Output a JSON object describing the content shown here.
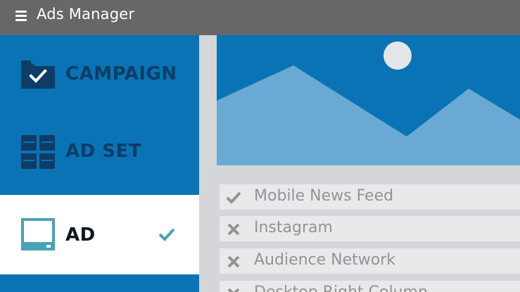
{
  "header": {
    "title": "Ads Manager",
    "menu_icon": "hamburger-menu-icon"
  },
  "sidebar": {
    "items": [
      {
        "label": "CAMPAIGN",
        "icon": "folder-check-icon",
        "selected": false
      },
      {
        "label": "AD SET",
        "icon": "grid-icon",
        "selected": false
      },
      {
        "label": "AD",
        "icon": "monitor-icon",
        "selected": true,
        "status_icon": "checkmark-icon"
      }
    ]
  },
  "preview": {
    "icon": "landscape-image-icon"
  },
  "placements": {
    "items": [
      {
        "label": "Mobile News Feed",
        "state": "checked",
        "icon": "checkmark-icon"
      },
      {
        "label": "Instagram",
        "state": "excluded",
        "icon": "x-icon"
      },
      {
        "label": "Audience Network",
        "state": "excluded",
        "icon": "x-icon"
      },
      {
        "label": "Desktop Right Column",
        "state": "excluded",
        "icon": "x-icon"
      }
    ]
  },
  "colors": {
    "header_bg": "#666769",
    "primary_blue": "#0a73b5",
    "dark_navy": "#0d3d66",
    "light_blue": "#6aa9d3",
    "teal": "#4aa2b5",
    "panel_grey": "#d4d6d9",
    "row_grey": "#e8e9eb",
    "text_grey": "#919497"
  }
}
